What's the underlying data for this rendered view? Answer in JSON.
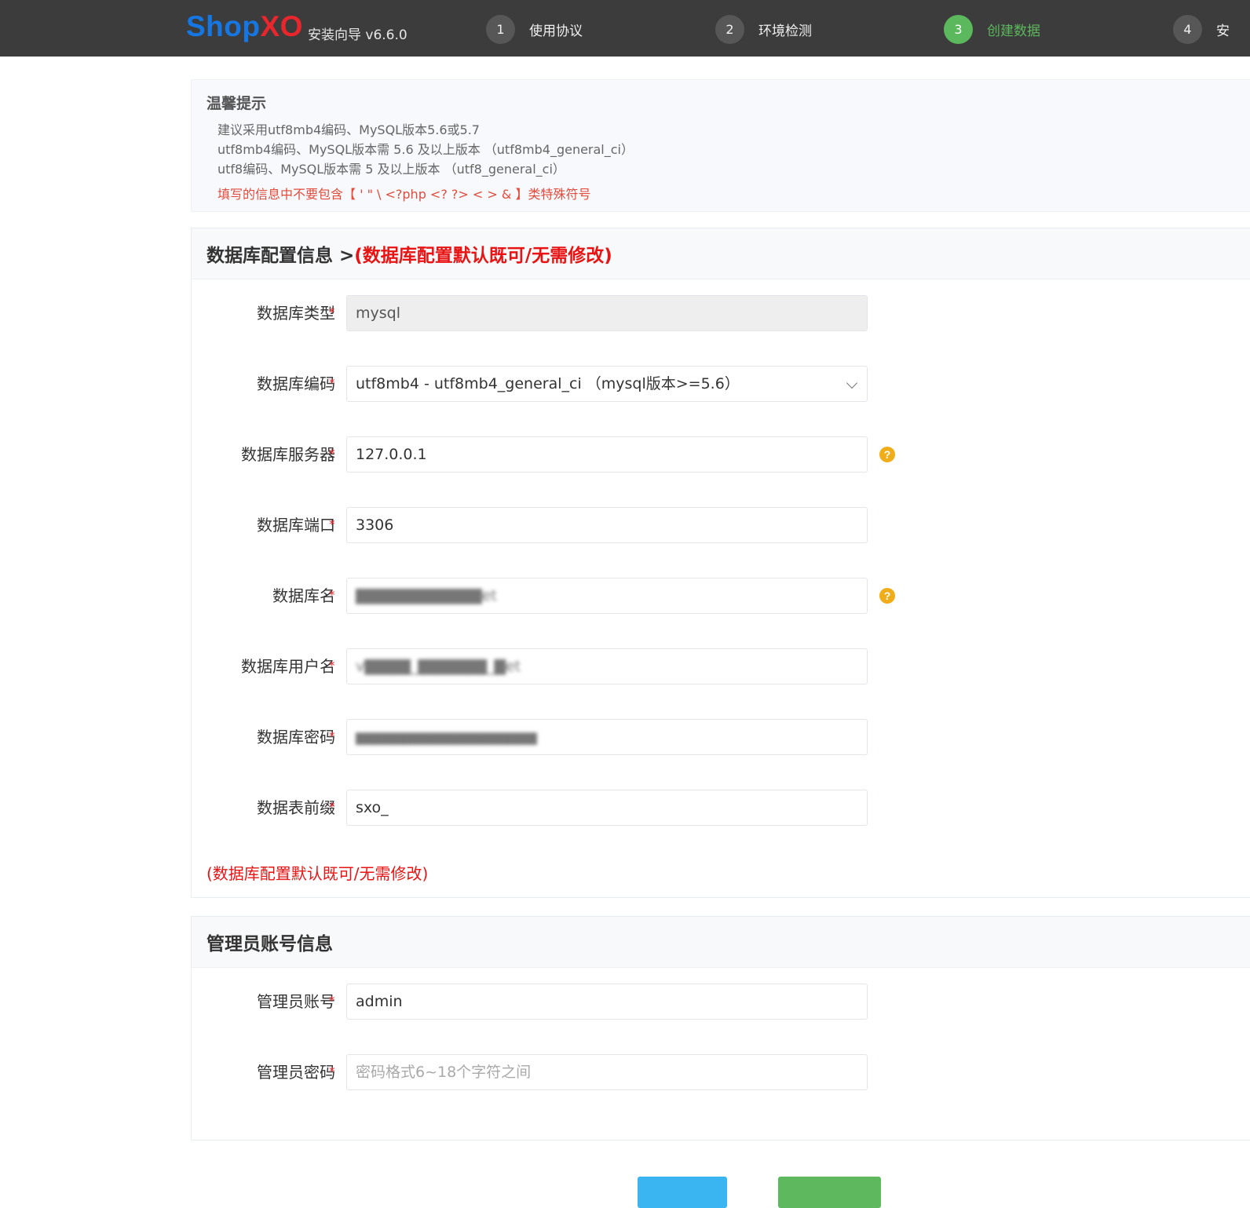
{
  "header": {
    "brand_part1": "Shop",
    "brand_part2": "XO",
    "subtitle": "安装向导 v6.6.0",
    "steps": [
      {
        "num": "1",
        "label": "使用协议",
        "active": false
      },
      {
        "num": "2",
        "label": "环境检测",
        "active": false
      },
      {
        "num": "3",
        "label": "创建数据",
        "active": true
      },
      {
        "num": "4",
        "label": "安",
        "active": false
      }
    ]
  },
  "tip": {
    "title": "温馨提示",
    "lines": [
      "建议采用utf8mb4编码、MySQL版本5.6或5.7",
      "utf8mb4编码、MySQL版本需 5.6 及以上版本 （utf8mb4_general_ci）",
      "utf8编码、MySQL版本需 5 及以上版本 （utf8_general_ci）"
    ],
    "warning": "填写的信息中不要包含【  '   \"   \\   <?php   <?   ?>   <   >   &  】类特殊符号"
  },
  "db_panel": {
    "title": "数据库配置信息 > ",
    "title_note": "(数据库配置默认既可/无需修改)",
    "required_mark": "*",
    "help_glyph": "?",
    "fields": [
      {
        "label": "数据库类型",
        "value": "mysql"
      },
      {
        "label": "数据库编码",
        "value": "utf8mb4 - utf8mb4_general_ci （mysql版本>=5.6）"
      },
      {
        "label": "数据库服务器",
        "value": "127.0.0.1"
      },
      {
        "label": "数据库端口",
        "value": "3306"
      },
      {
        "label": "数据库名",
        "value": "▇▇▇▇▇▇▇▇▇▇▇et"
      },
      {
        "label": "数据库用户名",
        "value": "v▇▇▇▇_▇▇▇▇▇▇_▇et"
      },
      {
        "label": "数据库密码",
        "value": "▇▇▇▇▇▇▇▇▇▇▇▇▇▇▇▇▇▇▇▇"
      },
      {
        "label": "数据表前缀",
        "value": "sxo_"
      }
    ],
    "footer_note": "(数据库配置默认既可/无需修改)"
  },
  "admin_panel": {
    "title": "管理员账号信息",
    "fields": [
      {
        "label": "管理员账号",
        "value": "admin"
      },
      {
        "label": "管理员密码",
        "placeholder": "密码格式6~18个字符之间"
      }
    ]
  },
  "colors": {
    "header_bg": "#3c3c3c",
    "brand_blue": "#1677e3",
    "brand_red": "#e8262c",
    "active_green": "#5cb85c",
    "warning_red": "#e81414",
    "help_orange": "#f0ad1a"
  },
  "icons": {
    "help": "question-circle-icon",
    "select": "chevron-down-icon"
  }
}
